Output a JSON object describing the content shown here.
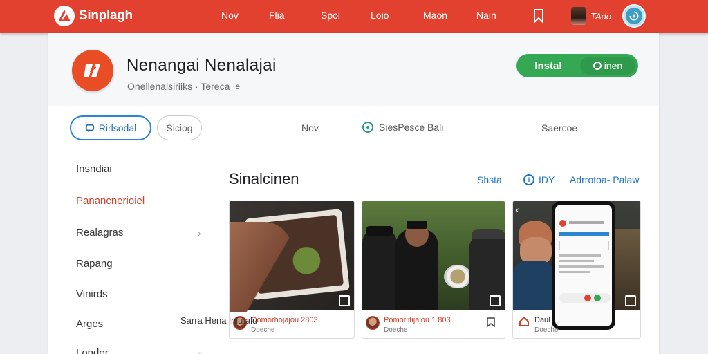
{
  "topbar": {
    "brand": "Sinplagh",
    "nav": [
      "Nov",
      "Flia",
      "Spoi",
      "Loio",
      "Maon",
      "Nain"
    ],
    "user_name": "TAdo",
    "icons": [
      "bookmark-icon",
      "profile-icon"
    ]
  },
  "app": {
    "title": "Nenangai Nenalajai",
    "subtitle": "Onellenalsiriiks · Tereca",
    "subtitle_mark": "e",
    "install_label": "Instal",
    "install_option": "inen"
  },
  "tabs": {
    "active": "Rirlsodal",
    "second": "Siciog",
    "middle": "Nov",
    "with_icon": "SiesPesce Bali",
    "right": "Saercoe"
  },
  "sidebar": {
    "items": [
      {
        "label": "Insndiai",
        "active": false,
        "chevron": false
      },
      {
        "label": "Panancnerioiel",
        "active": true,
        "chevron": false
      },
      {
        "label": "Realagras",
        "active": false,
        "chevron": true
      },
      {
        "label": "Rapang",
        "active": false,
        "chevron": false
      },
      {
        "label": "Vinirds",
        "active": false,
        "chevron": false
      },
      {
        "label": "Arges",
        "active": false,
        "chevron": false
      },
      {
        "label": "Londer",
        "active": false,
        "chevron": true
      }
    ]
  },
  "content": {
    "title": "Sinalcinen",
    "action_share": "Shsta",
    "action_info": "IDY",
    "action_review": "Adrrotoa- Palaw",
    "screenshots": [
      {
        "title": "Oomorhojajou 2803",
        "sub": "Doeche"
      },
      {
        "title": "Pomorlitijajou 1 803",
        "sub": "Doeche"
      },
      {
        "title": "Daul",
        "sub": "Doeche"
      }
    ],
    "bottom_peek": "Sarra Hena lnlu alu"
  },
  "colors": {
    "brand_red": "#e2412f",
    "install_green": "#34a853",
    "accent_blue": "#2a86d1"
  }
}
